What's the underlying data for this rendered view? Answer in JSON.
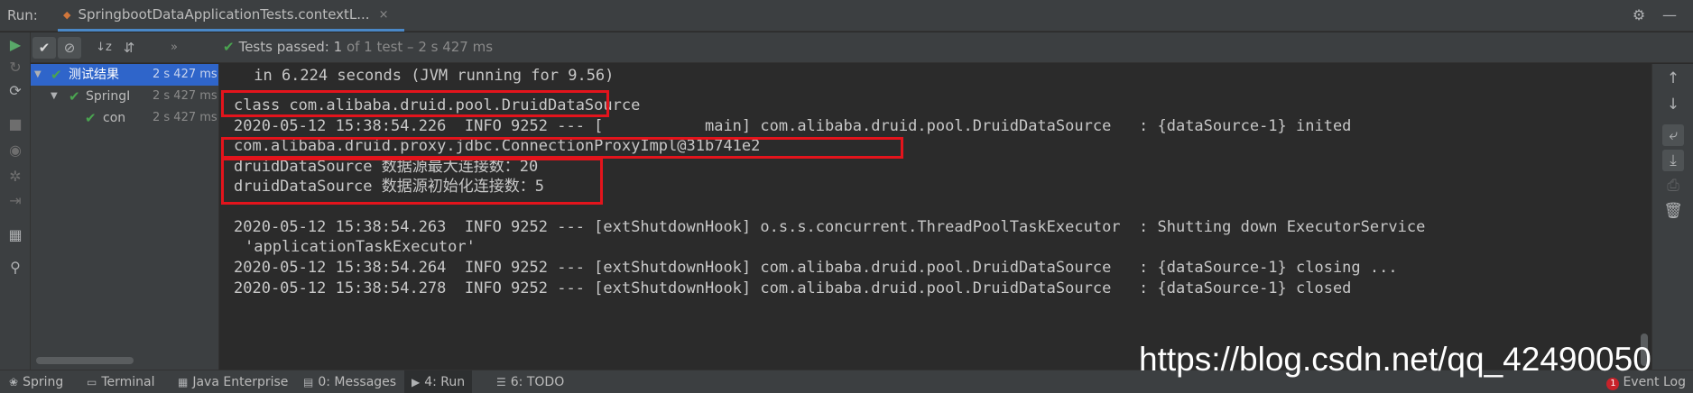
{
  "titlebar": {
    "run_label": "Run:",
    "tab_title": "SpringbootDataApplicationTests.contextL...",
    "tab_close": "×",
    "icons": [
      "gear-icon",
      "minimize-icon"
    ]
  },
  "testbar": {
    "status_prefix": "Tests passed: ",
    "status_count": "1",
    "status_rest": " of 1 test – 2 s 427 ms",
    "overflow_icon": "»"
  },
  "tree": {
    "items": [
      {
        "name": "测试结果",
        "time": "2 s 427 ms",
        "selected": true
      },
      {
        "name": "SpringI",
        "time": "2 s 427 ms",
        "selected": false
      },
      {
        "name": "con",
        "time": "2 s 427 ms",
        "selected": false
      }
    ]
  },
  "console": {
    "lines": [
      " in 6.224 seconds (JVM running for 9.56)",
      "",
      "class com.alibaba.druid.pool.DruidDataSource",
      "2020-05-12 15:38:54.226  INFO 9252 --- [           main] com.alibaba.druid.pool.DruidDataSource   : {dataSource-1} inited",
      "com.alibaba.druid.proxy.jdbc.ConnectionProxyImpl@31b741e2",
      "druidDataSource 数据源最大连接数：20",
      "druidDataSource 数据源初始化连接数：5",
      "",
      "2020-05-12 15:38:54.263  INFO 9252 --- [extShutdownHook] o.s.s.concurrent.ThreadPoolTaskExecutor  : Shutting down ExecutorService",
      "'applicationTaskExecutor'",
      "2020-05-12 15:38:54.264  INFO 9252 --- [extShutdownHook] com.alibaba.druid.pool.DruidDataSource   : {dataSource-1} closing ...",
      "2020-05-12 15:38:54.278  INFO 9252 --- [extShutdownHook] com.alibaba.druid.pool.DruidDataSource   : {dataSource-1} closed"
    ]
  },
  "bottombar": {
    "tabs": [
      {
        "label": "Spring",
        "icon": "spring-icon"
      },
      {
        "label": "Terminal",
        "icon": "terminal-icon"
      },
      {
        "label": "Java Enterprise",
        "icon": "java-enterprise-icon"
      },
      {
        "label": "0: Messages",
        "icon": "messages-icon"
      },
      {
        "label": "4: Run",
        "icon": "run-icon"
      },
      {
        "label": "6: TODO",
        "icon": "todo-icon"
      }
    ],
    "event_log": "Event Log",
    "event_badge": "1"
  },
  "watermark": "https://blog.csdn.net/qq_42490050",
  "colors": {
    "accent": "#4a88c7",
    "pass_green": "#4aa450",
    "highlight_red": "#e3141c",
    "selection": "#2f65ca"
  }
}
